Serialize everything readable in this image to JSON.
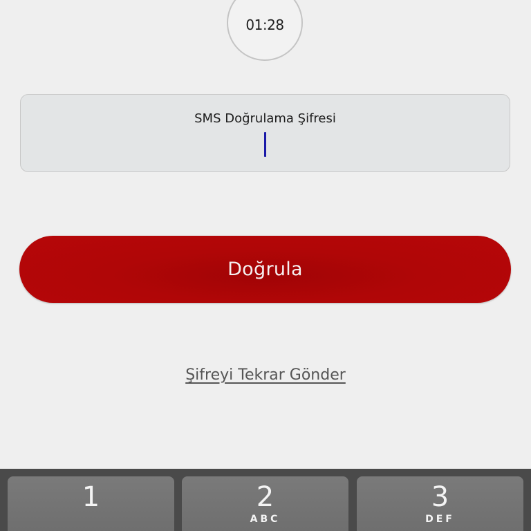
{
  "timer": {
    "text": "01:28"
  },
  "sms_field": {
    "label": "SMS Doğrulama Şifresi",
    "value": ""
  },
  "verify_button": {
    "label": "Doğrula",
    "color": "#b00607"
  },
  "resend_link": {
    "label": "Şifreyi Tekrar Gönder"
  },
  "keyboard": {
    "keys": [
      {
        "digit": "1",
        "letters": ""
      },
      {
        "digit": "2",
        "letters": "ABC"
      },
      {
        "digit": "3",
        "letters": "DEF"
      }
    ]
  }
}
